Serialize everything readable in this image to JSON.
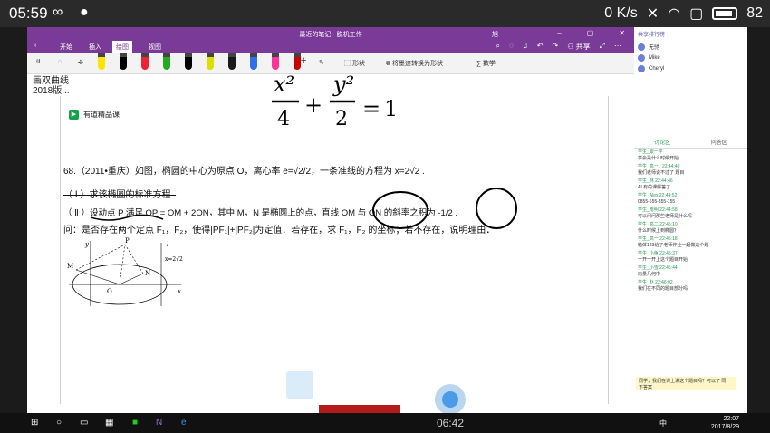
{
  "phone_status": {
    "time": "05:59",
    "network_speed": "0 K/s",
    "battery": "82"
  },
  "onenote": {
    "title": "最近的笔记 - 脱机工作",
    "user_short": "旭",
    "tabs": [
      "开始",
      "插入",
      "绘图",
      "视图"
    ],
    "active_tab": "绘图",
    "share_label": "共享",
    "toolbar": {
      "shapes_label": "形状",
      "ink_to_shape_label": "将墨迹转换为形状",
      "math_label": "数学"
    },
    "page": {
      "prev_text_line1": "画双曲线",
      "prev_text_line2": "2018版...",
      "logo_text": "有道精品课",
      "handwritten_equation": "x²/4 + y²/2 = 1",
      "q_line1": "68.（2011•重庆）如图，椭圆的中心为原点 O，离心率 e=√2/2，一条准线的方程为 x=2√2 .",
      "q_line2": "（ Ⅰ ）求该椭圆的标准方程 .",
      "q_line3": "（ Ⅱ ）设动点 P 满足 OP = OM + 2ON，其中 M，N 是椭圆上的点，直线 OM 与 ON 的斜率之积为 -1/2 .",
      "q_line4": "问：是否存在两个定点 F₁，F₂，使得|PF₁|+|PF₂|为定值．若存在，求 F₁，F₂ 的坐标；若不存在，说明理由．",
      "figure_labels": {
        "y": "y",
        "p": "P",
        "m": "M",
        "n": "N",
        "o": "O",
        "x": "x",
        "l": "l",
        "directrix": "x=2√2"
      }
    }
  },
  "side_panel": {
    "header": "共享排行榜",
    "users": [
      "无驰",
      "Mike",
      "Cheryl"
    ],
    "tabs": [
      "讨论区",
      "问答区"
    ],
    "active_tab": "讨论区",
    "messages": [
      {
        "meta": "学生_跟一平",
        "text": "学会是什么时候开始"
      },
      {
        "meta": "学生_高一.. 22:44:40",
        "text": "我们老师说不过了 题目"
      },
      {
        "meta": "学生_林 22:44:46",
        "text": "AI 有的课解答了"
      },
      {
        "meta": "学生_Alex 22:44:52",
        "text": "0855-655-355-155"
      },
      {
        "meta": "学生_南明 22:44:58",
        "text": "可以问问那些老师是什么吗"
      },
      {
        "meta": "学生_高二 22:45:10",
        "text": "什么时候上到椭圆？"
      },
      {
        "meta": "学生_高一 22:45:18",
        "text": "轴体123给了老师作业一起做这个题"
      },
      {
        "meta": "学生_小鱼 22:45:37",
        "text": "一开一开上这个题目开始"
      },
      {
        "meta": "学生_小雪 22:45:44",
        "text": "向量几何中"
      },
      {
        "meta": "学生_赵 22:46:02",
        "text": "我们在不同的题目部分吗"
      }
    ],
    "input_text": "同学，我们在课上讲这个题目吗？可以了 同一下答案"
  },
  "taskbar": {
    "center_time": "06:42",
    "clock_time": "22:07",
    "clock_date": "2017/8/29",
    "ime": "中"
  },
  "colors": {
    "onenote_purple": "#7a3a97",
    "chat_green": "#2a9d57",
    "logo_green": "#15a34a"
  }
}
